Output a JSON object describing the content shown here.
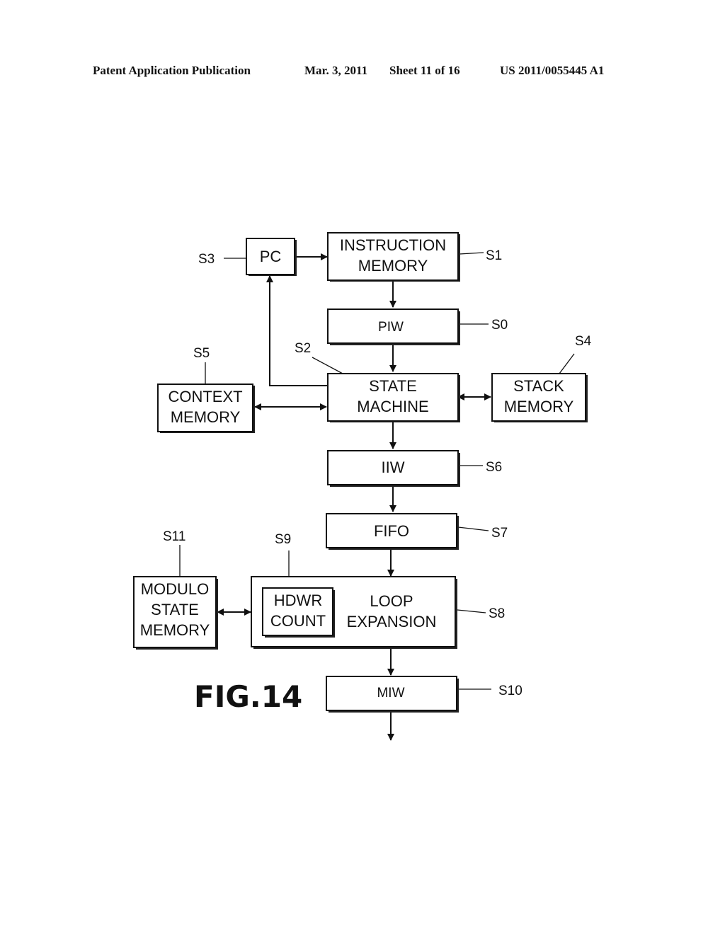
{
  "header": {
    "publication": "Patent Application Publication",
    "date": "Mar. 3, 2011",
    "sheet": "Sheet 11 of 16",
    "number": "US 2011/0055445 A1"
  },
  "figure_label": "FIG.14",
  "blocks": {
    "pc": {
      "lines": [
        "PC"
      ],
      "ref": "S3"
    },
    "instruction_memory": {
      "lines": [
        "INSTRUCTION",
        "MEMORY"
      ],
      "ref": "S1"
    },
    "piw": {
      "lines": [
        "PIW"
      ],
      "ref": "S0"
    },
    "state_machine": {
      "lines": [
        "STATE",
        "MACHINE"
      ],
      "ref": "S2"
    },
    "context_memory": {
      "lines": [
        "CONTEXT",
        "MEMORY"
      ],
      "ref": "S5"
    },
    "stack_memory": {
      "lines": [
        "STACK",
        "MEMORY"
      ],
      "ref": "S4"
    },
    "iiw": {
      "lines": [
        "IIW"
      ],
      "ref": "S6"
    },
    "fifo": {
      "lines": [
        "FIFO"
      ],
      "ref": "S7"
    },
    "loop_expansion": {
      "lines": [
        "LOOP",
        "EXPANSION"
      ],
      "ref": "S8"
    },
    "hdwr_count": {
      "lines": [
        "HDWR",
        "COUNT"
      ],
      "ref": "S9"
    },
    "modulo_state_memory": {
      "lines": [
        "MODULO",
        "STATE",
        "MEMORY"
      ],
      "ref": "S11"
    },
    "miw": {
      "lines": [
        "MIW"
      ],
      "ref": "S10"
    }
  }
}
